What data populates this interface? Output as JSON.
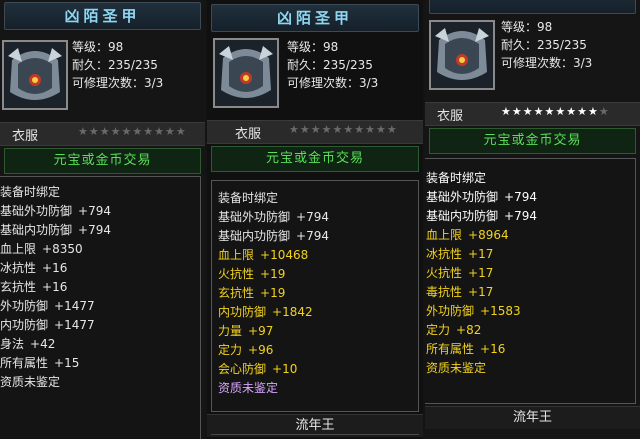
{
  "panels": [
    {
      "title": "凶陌圣甲",
      "level": "等级：98",
      "durability": "耐久：235/235",
      "repairs": "可修理次数：3/3",
      "type": "衣服",
      "stars_lit": 0,
      "stars_total": 10,
      "trade": "元宝或金币交易",
      "attributes": [
        {
          "label": "装备时绑定",
          "value": "",
          "color": "#e6e6e6"
        },
        {
          "label": "基础外功防御",
          "value": "+794",
          "color": "#e6e6e6"
        },
        {
          "label": "基础内功防御",
          "value": "+794",
          "color": "#e6e6e6"
        },
        {
          "label": "血上限",
          "value": "+8350",
          "color": "#e6e6e6"
        },
        {
          "label": "冰抗性",
          "value": "+16",
          "color": "#e6e6e6"
        },
        {
          "label": "玄抗性",
          "value": "+16",
          "color": "#e6e6e6"
        },
        {
          "label": "外功防御",
          "value": "+1477",
          "color": "#e6e6e6"
        },
        {
          "label": "内功防御",
          "value": "+1477",
          "color": "#e6e6e6"
        },
        {
          "label": "身法",
          "value": "+42",
          "color": "#e6e6e6"
        },
        {
          "label": "所有属性",
          "value": "+15",
          "color": "#e6e6e6"
        },
        {
          "label": "资质未鉴定",
          "value": "",
          "color": "#e6e6e6"
        }
      ],
      "owner": ""
    },
    {
      "title": "凶陌圣甲",
      "level": "等级：98",
      "durability": "耐久：235/235",
      "repairs": "可修理次数：3/3",
      "type": "衣服",
      "stars_lit": 0,
      "stars_total": 10,
      "trade": "元宝或金币交易",
      "attributes": [
        {
          "label": "装备时绑定",
          "value": "",
          "color": "#e6e6e6"
        },
        {
          "label": "基础外功防御",
          "value": "+794",
          "color": "#e6e6e6"
        },
        {
          "label": "基础内功防御",
          "value": "+794",
          "color": "#e6e6e6"
        },
        {
          "label": "血上限",
          "value": "+10468",
          "color": "#f2d21e"
        },
        {
          "label": "火抗性",
          "value": "+19",
          "color": "#f2d21e"
        },
        {
          "label": "玄抗性",
          "value": "+19",
          "color": "#f2d21e"
        },
        {
          "label": "内功防御",
          "value": "+1842",
          "color": "#f2d21e"
        },
        {
          "label": "力量",
          "value": "+97",
          "color": "#f2d21e"
        },
        {
          "label": "定力",
          "value": "+96",
          "color": "#f2d21e"
        },
        {
          "label": "会心防御",
          "value": "+10",
          "color": "#f2d21e"
        },
        {
          "label": "资质未鉴定",
          "value": "",
          "color": "#d9a6ff"
        }
      ],
      "owner": "流年王"
    },
    {
      "title": "",
      "level": "等级：98",
      "durability": "耐久：235/235",
      "repairs": "可修理次数：3/3",
      "type": "衣服",
      "stars_lit": 9,
      "stars_total": 10,
      "trade": "元宝或金币交易",
      "attributes": [
        {
          "label": "装备时绑定",
          "value": "",
          "color": "#ffffff"
        },
        {
          "label": "基础外功防御",
          "value": "+794",
          "color": "#ffffff"
        },
        {
          "label": "基础内功防御",
          "value": "+794",
          "color": "#ffffff"
        },
        {
          "label": "血上限",
          "value": "+8964",
          "color": "#f2d21e"
        },
        {
          "label": "冰抗性",
          "value": "+17",
          "color": "#f2d21e"
        },
        {
          "label": "火抗性",
          "value": "+17",
          "color": "#f2d21e"
        },
        {
          "label": "毒抗性",
          "value": "+17",
          "color": "#f2d21e"
        },
        {
          "label": "外功防御",
          "value": "+1583",
          "color": "#f2d21e"
        },
        {
          "label": "定力",
          "value": "+82",
          "color": "#f2d21e"
        },
        {
          "label": "所有属性",
          "value": "+16",
          "color": "#f2d21e"
        },
        {
          "label": "资质未鉴定",
          "value": "",
          "color": "#f2d21e"
        }
      ],
      "owner": "流年王"
    }
  ],
  "icons": {
    "portrait": "armor-portrait-icon",
    "star": "star-icon"
  }
}
